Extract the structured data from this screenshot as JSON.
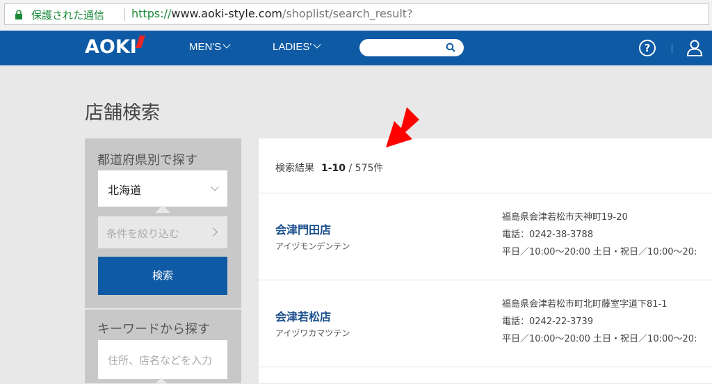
{
  "browser": {
    "secure_label": "保護された通信",
    "url_scheme": "https://",
    "url_host": "www.aoki-style.com",
    "url_path": "/shoplist/search_result?"
  },
  "nav": {
    "logo": "AOKI",
    "mens": "MEN'S",
    "ladies": "LADIES'",
    "help": "?"
  },
  "page": {
    "title": "店舗検索"
  },
  "sidebar": {
    "pref_heading": "都道府県別で探す",
    "pref_selected": "北海道",
    "narrow_label": "条件を絞り込む",
    "search_button": "検索",
    "keyword_heading": "キーワードから探す",
    "keyword_placeholder": "住所、店名などを入力"
  },
  "results": {
    "label": "検索結果",
    "range": "1-10",
    "total": "/ 575件",
    "stores": [
      {
        "name": "会津門田店",
        "kana": "アイヅモンデンテン",
        "address": "福島県会津若松市天神町19-20",
        "phone": "電話：0242-38-3788",
        "hours": "平日／10:00～20:00 土日・祝日／10:00～20:"
      },
      {
        "name": "会津若松店",
        "kana": "アイヅワカマツテン",
        "address": "福島県会津若松市町北町藤室字道下81-1",
        "phone": "電話：0242-22-3739",
        "hours": "平日／10:00～20:00 土日・祝日／10:00～20:"
      }
    ]
  },
  "colors": {
    "brand_blue": "#0f5aa5",
    "annotation_arrow": "#ff0000",
    "secure_green": "#1a8a39"
  }
}
